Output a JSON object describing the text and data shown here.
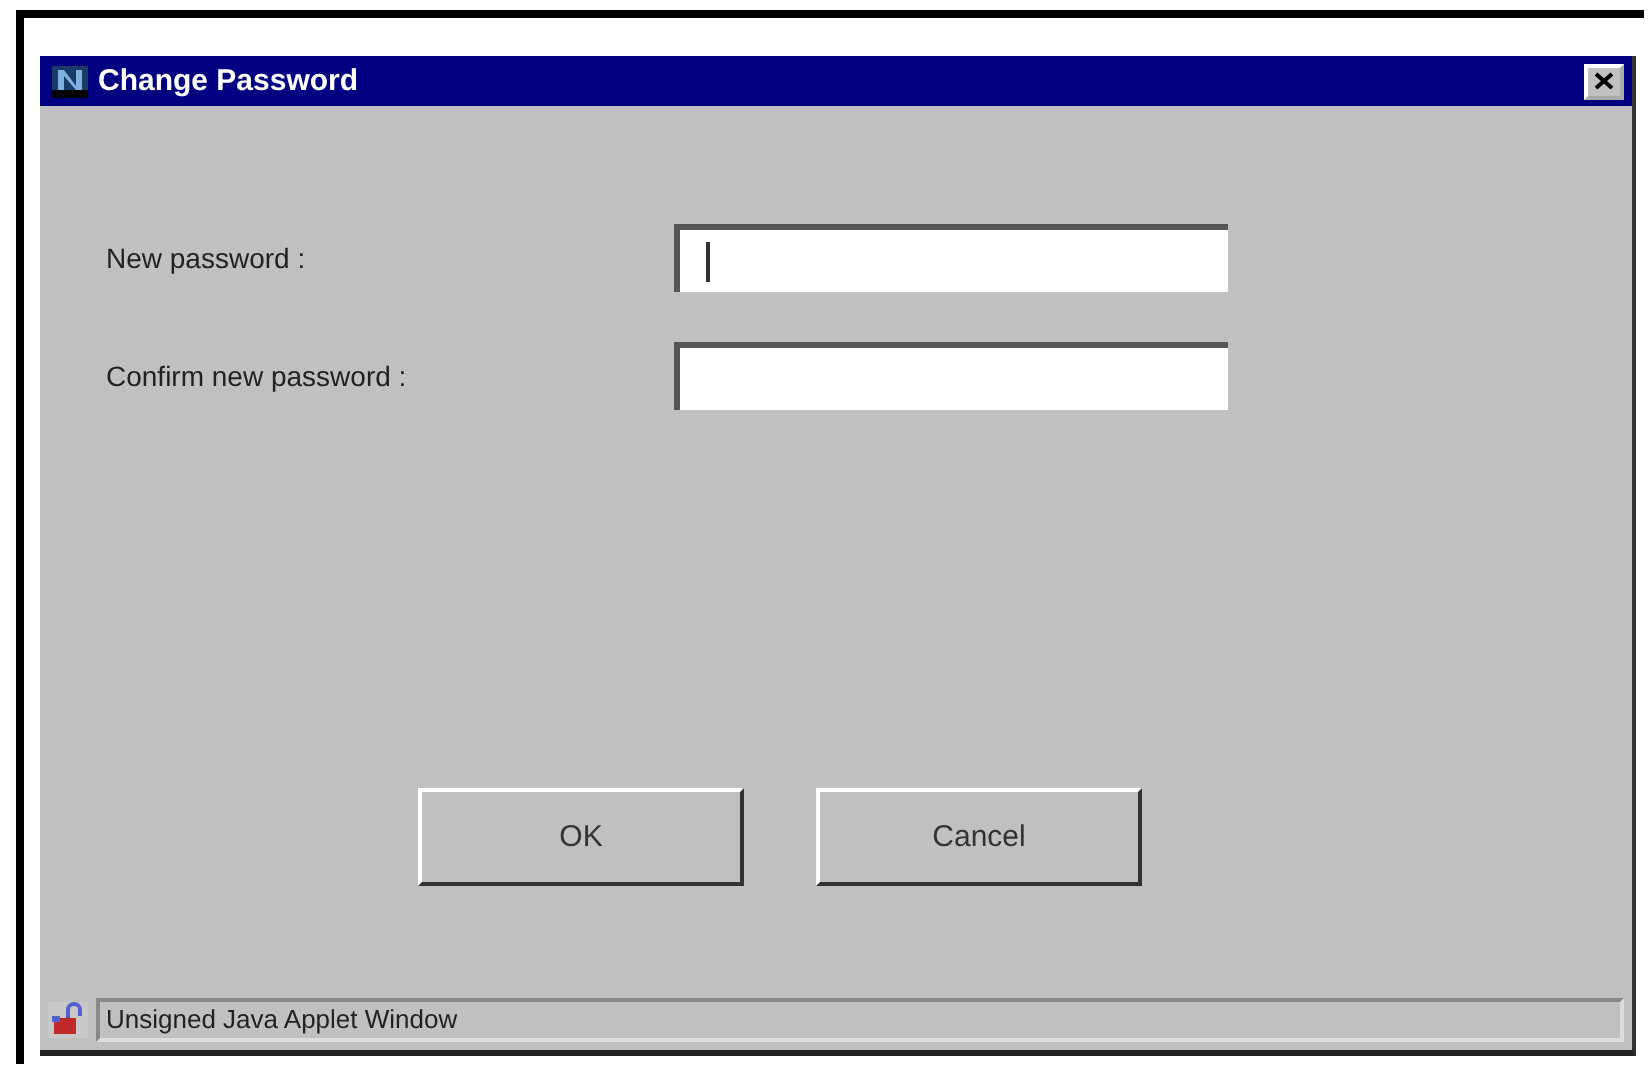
{
  "window": {
    "title": "Change Password"
  },
  "fields": [
    {
      "label": "New password :",
      "focused": true
    },
    {
      "label": "Confirm new password :",
      "focused": false
    }
  ],
  "buttons": [
    "OK",
    "Cancel"
  ],
  "status_bar": {
    "text": "Unsigned Java Applet Window"
  }
}
